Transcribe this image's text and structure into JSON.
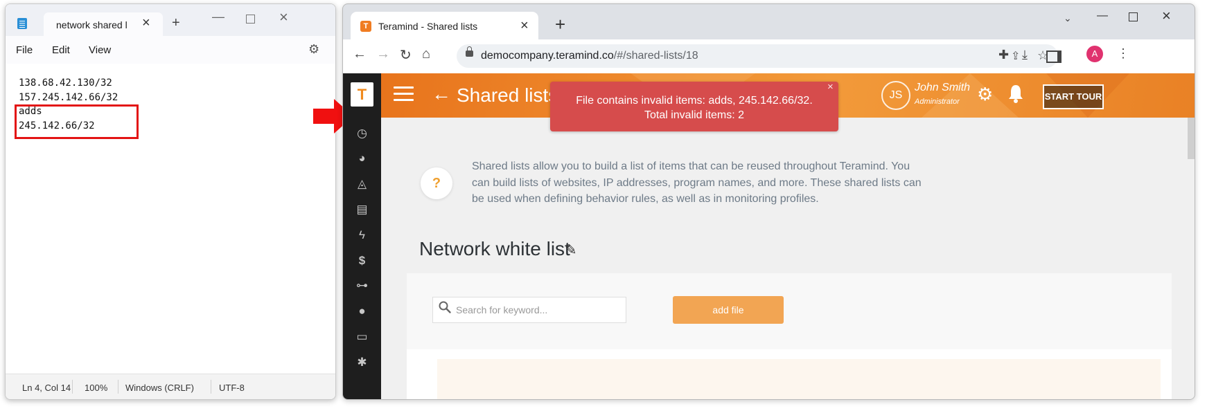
{
  "notepad": {
    "tab_title": "network shared l",
    "menu": [
      "File",
      "Edit",
      "View"
    ],
    "lines": [
      "138.68.42.130/32",
      "157.245.142.66/32",
      "adds",
      "245.142.66/32"
    ],
    "status": {
      "position": "Ln 4, Col 14",
      "zoom": "100%",
      "line_ending": "Windows (CRLF)",
      "encoding": "UTF-8"
    },
    "icons": [
      "notepad-icon",
      "close-icon",
      "plus-icon",
      "minimize-icon",
      "maximize-icon",
      "settings-icon"
    ],
    "highlight_color": "#e31414"
  },
  "annotation": {
    "arrow_color": "#f01010"
  },
  "browser": {
    "tab_title": "Teramind - Shared lists",
    "favicon_letter": "T",
    "url_host": "democompany.teramind.co",
    "url_path": "/#/shared-lists/18",
    "profile_initial": "A",
    "profile_color": "#e0326f"
  },
  "teramind": {
    "logo_letter": "T",
    "page_title": "Shared lists",
    "user": {
      "initials": "JS",
      "name": "John Smith",
      "role": "Administrator"
    },
    "start_tour_label": "START TOUR",
    "toast": {
      "message": "File contains invalid items: adds, 245.142.66/32. Total invalid items: 2",
      "close": "×",
      "color": "#d64c4c"
    },
    "help_mark": "?",
    "help_text": "Shared lists allow you to build a list of items that can be reused throughout Teramind. You can build lists of websites, IP addresses, program names, and more. These shared lists can be used when defining behavior rules, as well as in monitoring profiles.",
    "list_title": "Network white list",
    "search_placeholder": "Search for keyword...",
    "add_file_label": "add file",
    "sidebar_icons": [
      "clock-icon",
      "pie-chart-icon",
      "area-chart-icon",
      "document-icon",
      "lightning-icon",
      "dollar-icon",
      "gamepad-icon",
      "users-icon",
      "monitor-icon",
      "cog-icon"
    ],
    "accent_color": "#f08a1e"
  }
}
